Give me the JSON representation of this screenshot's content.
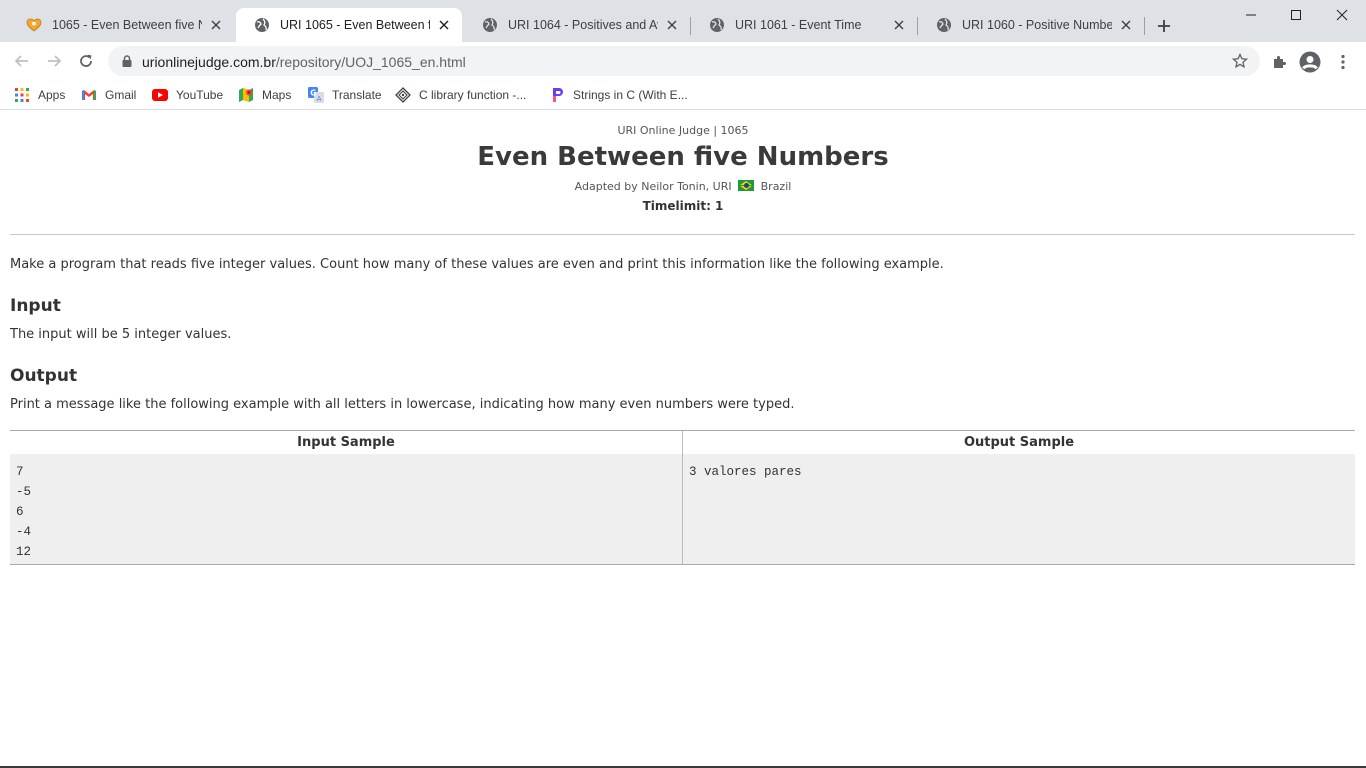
{
  "browser": {
    "tabs": [
      {
        "title": "1065 - Even Between five Num",
        "favicon": "heart-shield-icon"
      },
      {
        "title": "URI 1065 - Even Between five N",
        "favicon": "globe-icon",
        "active": true
      },
      {
        "title": "URI 1064 - Positives and Avera",
        "favicon": "globe-icon"
      },
      {
        "title": "URI 1061 - Event Time",
        "favicon": "globe-icon"
      },
      {
        "title": "URI 1060 - Positive Numbers",
        "favicon": "globe-icon"
      }
    ],
    "address": {
      "domain": "urionlinejudge.com.br",
      "path": "/repository/UOJ_1065_en.html"
    },
    "bookmarks": [
      {
        "label": "Apps",
        "icon": "apps-grid-icon"
      },
      {
        "label": "Gmail",
        "icon": "gmail-icon"
      },
      {
        "label": "YouTube",
        "icon": "youtube-icon"
      },
      {
        "label": "Maps",
        "icon": "maps-icon"
      },
      {
        "label": "Translate",
        "icon": "translate-icon"
      },
      {
        "label": "C library function -...",
        "icon": "cube-icon"
      },
      {
        "label": "Strings in C (With E...",
        "icon": "programiz-icon"
      }
    ]
  },
  "problem": {
    "judge_line": "URI Online Judge | 1065",
    "title": "Even Between five Numbers",
    "author_prefix": "Adapted by Neilor Tonin, URI",
    "author_country": "Brazil",
    "timelimit": "Timelimit: 1",
    "description": "Make a program that reads five integer values. Count how many of these values are even and  print this information like the following example.",
    "input_heading": "Input",
    "input_text": "The input will be 5 integer values.",
    "output_heading": "Output",
    "output_text": "Print a message like the following example with all letters in lowercase, indicating how many even numbers were typed.",
    "samples": {
      "input_header": "Input Sample",
      "output_header": "Output Sample",
      "input_lines": [
        "7",
        "-5",
        "6",
        "-4",
        "12"
      ],
      "output_lines": [
        "3 valores pares"
      ]
    }
  }
}
